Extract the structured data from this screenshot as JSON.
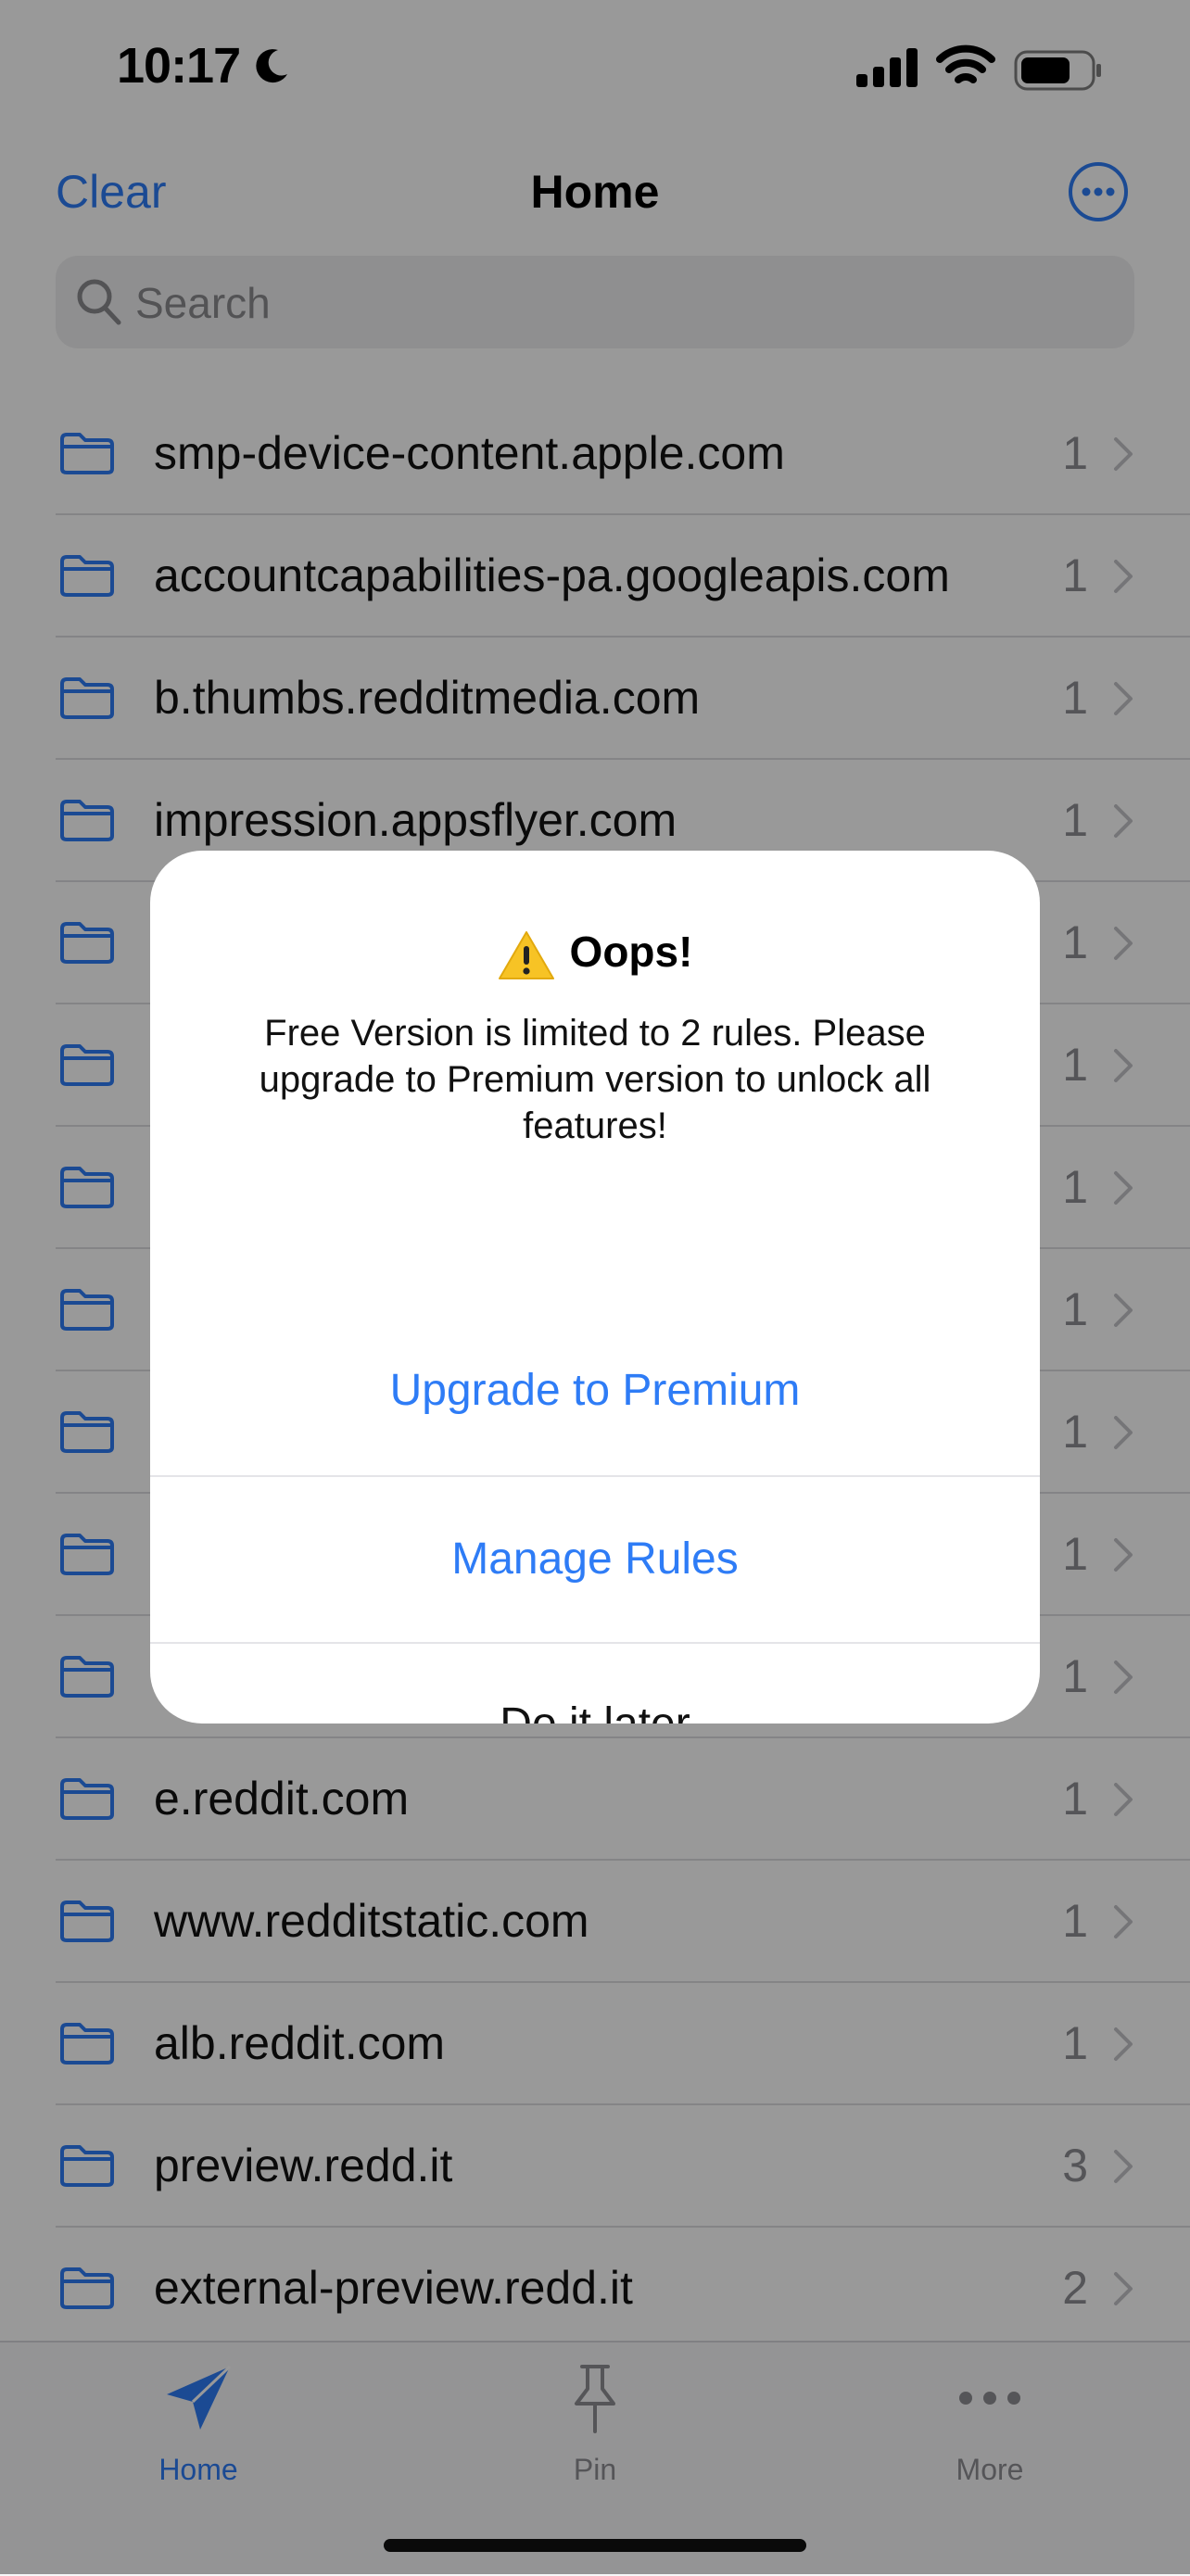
{
  "status_bar": {
    "time": "10:17"
  },
  "nav": {
    "left": "Clear",
    "title": "Home"
  },
  "search": {
    "placeholder": "Search"
  },
  "rows": [
    {
      "domain": "smp-device-content.apple.com",
      "count": "1"
    },
    {
      "domain": "accountcapabilities-pa.googleapis.com",
      "count": "1"
    },
    {
      "domain": "b.thumbs.redditmedia.com",
      "count": "1"
    },
    {
      "domain": "impression.appsflyer.com",
      "count": "1"
    },
    {
      "domain": "",
      "count": "1"
    },
    {
      "domain": "",
      "count": "1"
    },
    {
      "domain": "",
      "count": "1"
    },
    {
      "domain": "",
      "count": "1"
    },
    {
      "domain": "",
      "count": "1"
    },
    {
      "domain": "",
      "count": "1"
    },
    {
      "domain": "",
      "count": "1"
    },
    {
      "domain": "e.reddit.com",
      "count": "1"
    },
    {
      "domain": "www.redditstatic.com",
      "count": "1"
    },
    {
      "domain": "alb.reddit.com",
      "count": "1"
    },
    {
      "domain": "preview.redd.it",
      "count": "3"
    },
    {
      "domain": "external-preview.redd.it",
      "count": "2"
    }
  ],
  "tabs": [
    {
      "label": "Home",
      "icon": "paper-plane-icon",
      "active": true
    },
    {
      "label": "Pin",
      "icon": "pin-icon",
      "active": false
    },
    {
      "label": "More",
      "icon": "ellipsis-icon",
      "active": false
    }
  ],
  "alert": {
    "icon": "warning-icon",
    "title": "Oops!",
    "message": "Free Version is limited to 2 rules. Please upgrade to Premium version to unlock all features!",
    "buttons": {
      "upgrade": "Upgrade to Premium",
      "manage": "Manage Rules",
      "later": "Do it later"
    }
  },
  "colors": {
    "accent": "#2e7cf6",
    "folder": "#2e7cf6"
  }
}
